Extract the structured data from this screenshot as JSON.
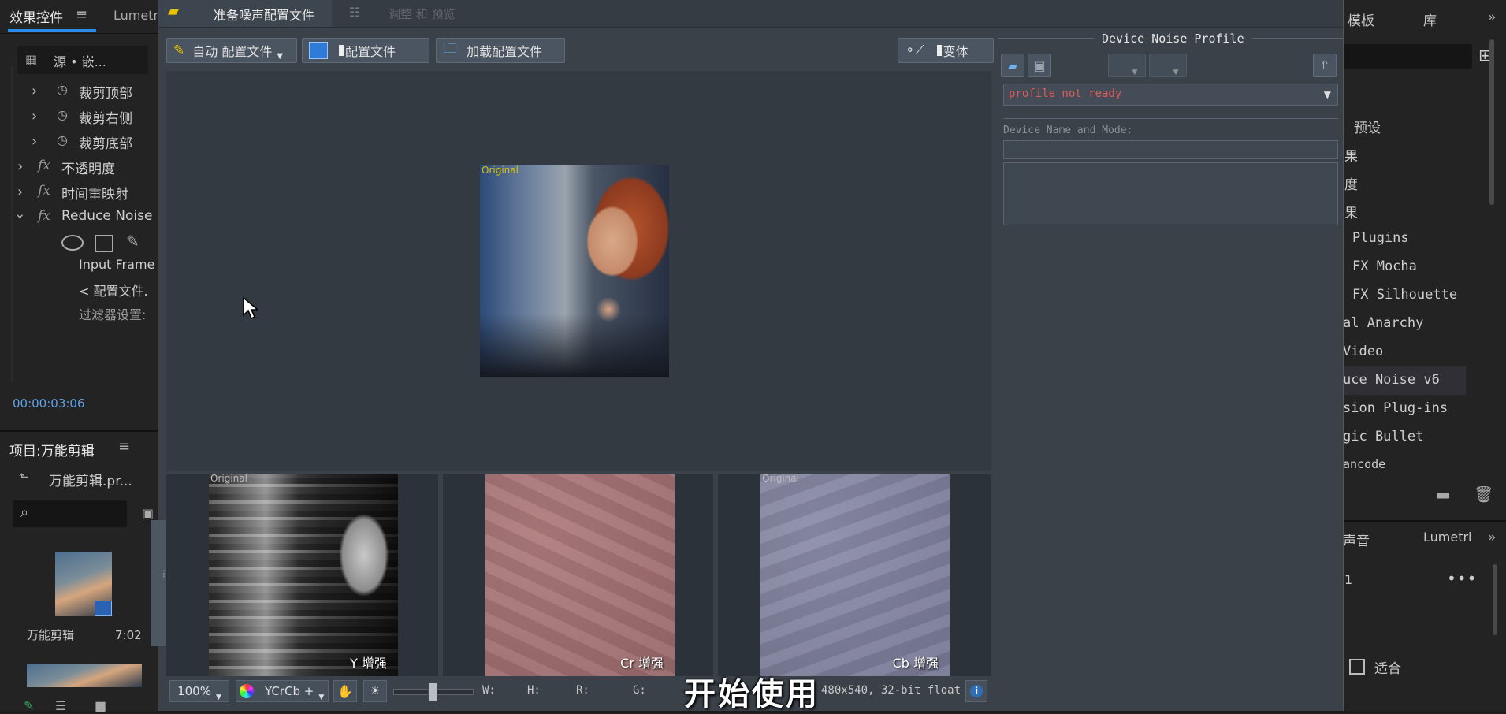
{
  "left_panel": {
    "tabs": [
      "效果控件",
      "Lumetri"
    ],
    "source_label": "源 • 嵌...",
    "rows": [
      {
        "label": "裁剪顶部"
      },
      {
        "label": "裁剪右侧"
      },
      {
        "label": "裁剪底部"
      }
    ],
    "fx_rows": [
      {
        "label": "不透明度"
      },
      {
        "label": "时间重映射"
      },
      {
        "label": "Reduce Noise"
      }
    ],
    "sub_rows": [
      "Input Frame",
      "< 配置文件.",
      "过滤器设置:"
    ],
    "timecode": "00:00:03:06",
    "project_title": "项目:万能剪辑",
    "project_file": "万能剪辑.pr...",
    "clip_name": "万能剪辑",
    "clip_duration": "7:02"
  },
  "dialog": {
    "tabs": [
      {
        "label": "准备噪声配置文件"
      },
      {
        "label": "调整 和 预览"
      }
    ],
    "toolbar": {
      "auto_profile": "自动 配置文件",
      "profile": "配置文件",
      "load_profile": "加载配置文件",
      "variant": "变体"
    },
    "preview": {
      "original_label": "Original"
    },
    "strips": [
      {
        "label": "Y 增强",
        "corner": "Original"
      },
      {
        "label": "Cr 增强",
        "corner": ""
      },
      {
        "label": "Cb 增强",
        "corner": "Original"
      }
    ],
    "status": {
      "zoom": "100%",
      "colorspace": "YCrCb +",
      "w_label": "W:",
      "h_label": "H:",
      "r_label": "R:",
      "g_label": "G:",
      "info": "480x540, 32-bit float"
    },
    "profile_panel": {
      "title": "Device Noise Profile",
      "status": "profile not ready",
      "device_label": "Device Name and Mode:"
    }
  },
  "right_panel": {
    "tabs": [
      "模板",
      "库"
    ],
    "items": [
      "预设",
      "果",
      "度",
      "果",
      "Plugins",
      "FX Mocha",
      "FX Silhouette",
      "al Anarchy",
      "Video",
      "uce Noise v6",
      "sion Plug-ins",
      "gic Bullet",
      "ancode"
    ],
    "lower_tabs": [
      "声音",
      "Lumetri"
    ],
    "lower_value": "1",
    "fit_label": "适合"
  },
  "subtitle": "开始使用"
}
